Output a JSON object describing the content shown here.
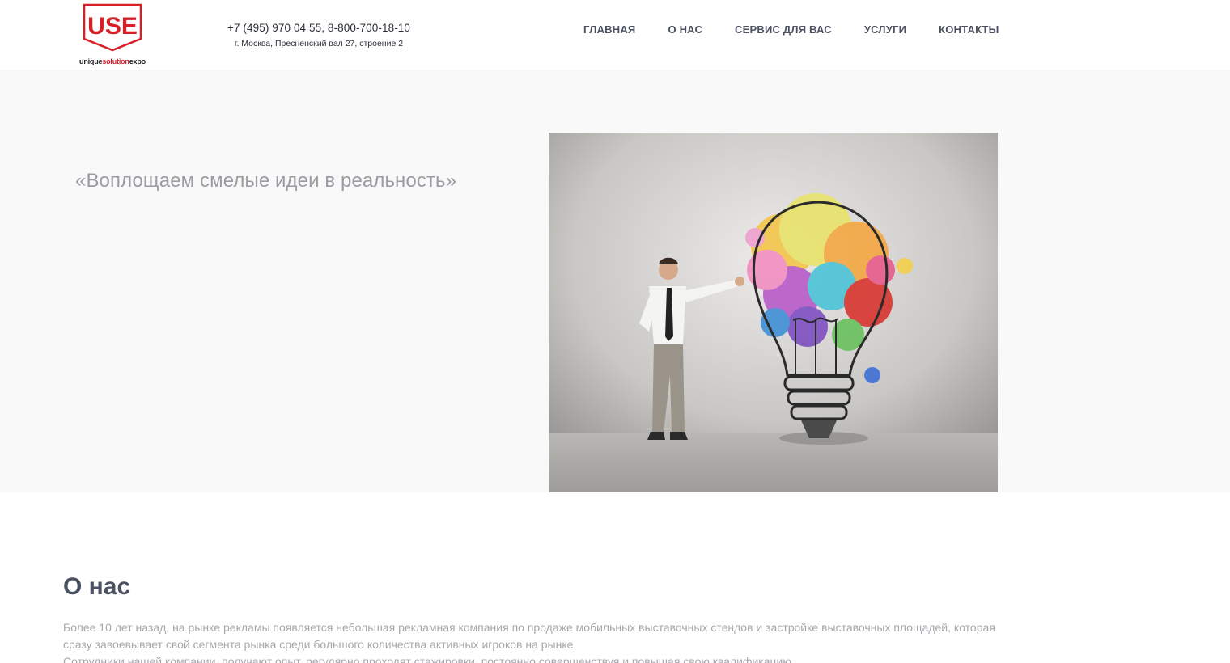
{
  "logo": {
    "mark": "USE",
    "tagline_prefix": "unique",
    "tagline_accent": "solution",
    "tagline_suffix": "expo",
    "brand_color": "#d71f27"
  },
  "contacts": {
    "phone": "+7 (495) 970 04 55, 8-800-700-18-10",
    "address": "г. Москва, Пресненский вал 27, строение 2"
  },
  "nav": {
    "items": [
      {
        "label": "ГЛАВНАЯ"
      },
      {
        "label": "О НАС"
      },
      {
        "label": "СЕРВИС ДЛЯ ВАС"
      },
      {
        "label": "УСЛУГИ"
      },
      {
        "label": "КОНТАКТЫ"
      }
    ]
  },
  "hero": {
    "tagline": "«Воплощаем смелые идеи в реальность»"
  },
  "about": {
    "title": "О нас",
    "paragraphs": [
      "Более 10 лет назад, на рынке рекламы появляется небольшая рекламная компания по продаже мобильных выставочных стендов и застройке выставочных площадей, которая сразу завоевывает свой сегмента рынка среди большого количества активных игроков на рынке.",
      "Сотрудники нашей компании, получают опыт, регулярно проходят стажировки, постоянно совершенствуя и повышая свою квалификацию."
    ]
  },
  "colors": {
    "nav_text": "#4a5161",
    "hero_bg": "#f9f9f9",
    "muted_text": "#a6a8ac"
  }
}
